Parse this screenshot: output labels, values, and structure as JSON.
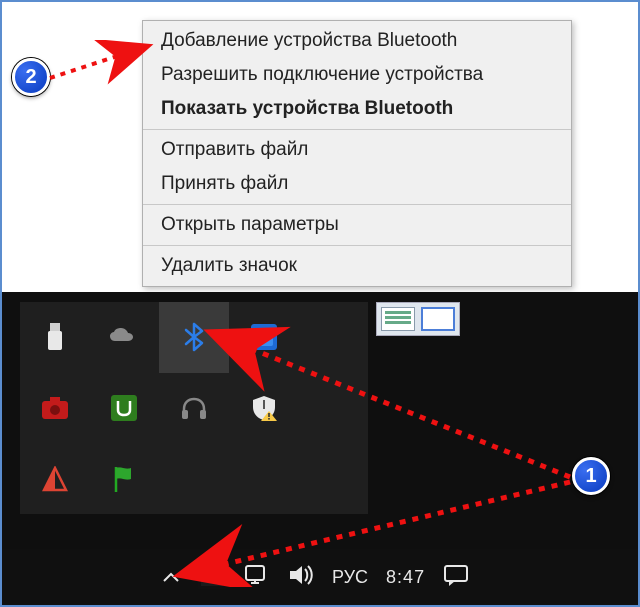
{
  "context_menu": {
    "group1": [
      {
        "label": "Добавление устройства Bluetooth",
        "bold": false
      },
      {
        "label": "Разрешить подключение устройства",
        "bold": false
      },
      {
        "label": "Показать устройства Bluetooth",
        "bold": true
      }
    ],
    "group2": [
      {
        "label": "Отправить файл",
        "bold": false
      },
      {
        "label": "Принять файл",
        "bold": false
      }
    ],
    "group3": [
      {
        "label": "Открыть параметры",
        "bold": false
      }
    ],
    "group4": [
      {
        "label": "Удалить значок",
        "bold": false
      }
    ]
  },
  "tray_icons": {
    "row1": [
      "usb-icon",
      "onedrive-icon",
      "bluetooth-icon",
      "intel-icon",
      ""
    ],
    "row2": [
      "camera-icon",
      "utorrent-icon",
      "headphones-icon",
      "security-warn-icon",
      ""
    ],
    "row3": [
      "action-icon",
      "flag-icon",
      "",
      "",
      ""
    ],
    "active_col": 2
  },
  "taskbar": {
    "lang": "РУС",
    "time": "8:47"
  },
  "callouts": {
    "badge1": "1",
    "badge2": "2"
  },
  "colors": {
    "accent": "#0b4fd6",
    "arrow": "#e11",
    "bt": "#2b7de9"
  }
}
